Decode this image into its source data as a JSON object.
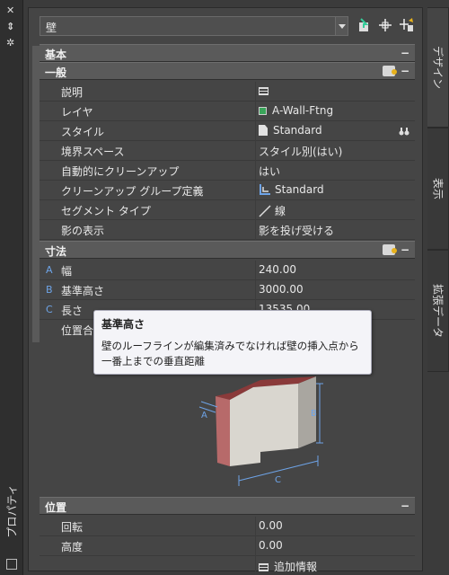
{
  "window": {
    "title": "プロパティ"
  },
  "toolbar": {
    "object_type": "壁"
  },
  "sections": {
    "basic": "基本",
    "general": "一般",
    "dimensions": "寸法",
    "location": "位置"
  },
  "general_rows": [
    {
      "label": "説明",
      "value": ""
    },
    {
      "label": "レイヤ",
      "value": "A-Wall-Ftng"
    },
    {
      "label": "スタイル",
      "value": "Standard"
    },
    {
      "label": "境界スペース",
      "value": "スタイル別(はい)"
    },
    {
      "label": "自動的にクリーンアップ",
      "value": "はい"
    },
    {
      "label": "クリーンアップ グループ定義",
      "value": "Standard"
    },
    {
      "label": "セグメント タイプ",
      "value": "線"
    },
    {
      "label": "影の表示",
      "value": "影を投げ受ける"
    }
  ],
  "dimension_rows": [
    {
      "letter": "A",
      "label": "幅",
      "value": "240.00"
    },
    {
      "letter": "B",
      "label": "基準高さ",
      "value": "3000.00"
    },
    {
      "letter": "C",
      "label": "長さ",
      "value": "13535.00"
    },
    {
      "letter": "",
      "label": "位置合",
      "value": ""
    }
  ],
  "location_rows": [
    {
      "label": "回転",
      "value": "0.00"
    },
    {
      "label": "高度",
      "value": "0.00"
    },
    {
      "label": "",
      "value": "追加情報"
    }
  ],
  "tooltip": {
    "title": "基準高さ",
    "body": "壁のルーフラインが編集済みでなければ壁の挿入点から一番上までの垂直距離"
  },
  "diagram": {
    "label_a": "A",
    "label_b": "B",
    "label_c": "C"
  },
  "tabs": [
    "デザイン",
    "表示",
    "拡張データ"
  ],
  "colors": {
    "panel": "#454545",
    "section": "#5a5a5a",
    "accent_blue": "#6ea4e8",
    "layer_green": "#3aa55a"
  }
}
